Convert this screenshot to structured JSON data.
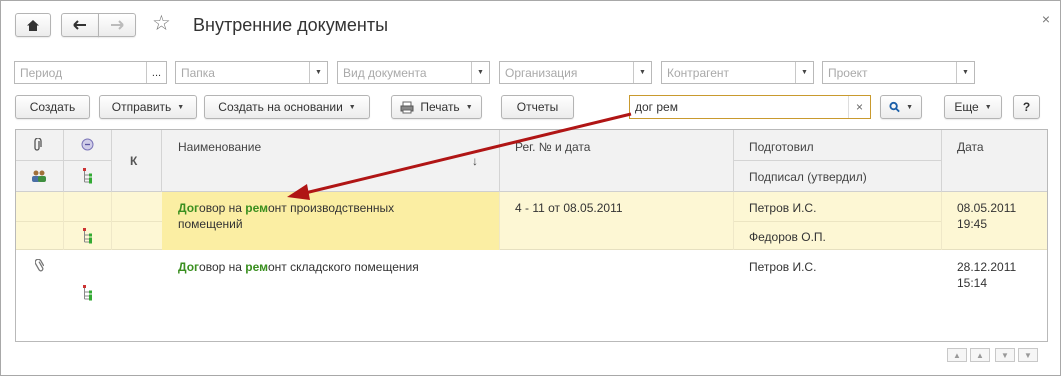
{
  "window": {
    "title": "Внутренние документы"
  },
  "filters": [
    {
      "placeholder": "Период"
    },
    {
      "placeholder": "Папка"
    },
    {
      "placeholder": "Вид документа"
    },
    {
      "placeholder": "Организация"
    },
    {
      "placeholder": "Контрагент"
    },
    {
      "placeholder": "Проект"
    }
  ],
  "toolbar": {
    "create": "Создать",
    "send": "Отправить",
    "create_based_on": "Создать на основании",
    "print": "Печать",
    "reports": "Отчеты",
    "more": "Еще",
    "help": "?"
  },
  "search": {
    "value": "дог рем",
    "clear": "×"
  },
  "columns": {
    "k": "К",
    "name": "Наименование",
    "sort_arrow": "↓",
    "reg": "Рег. № и дата",
    "prepared": "Подготовил",
    "signed": "Подписал (утвердил)",
    "date": "Дата"
  },
  "rows": [
    {
      "name_hl1": "Дог",
      "name_mid1": "овор на ",
      "name_hl2": "рем",
      "name_rest1": "онт производственных",
      "name_line2": "помещений",
      "reg": "4 - 11 от 08.05.2011",
      "prepared": "Петров И.С.",
      "signed": "Федоров О.П.",
      "date1": "08.05.2011",
      "date2": "19:45"
    },
    {
      "name_hl1": "Дог",
      "name_mid1": "овор на ",
      "name_hl2": "рем",
      "name_rest1": "онт складского помещения",
      "prepared": "Петров И.С.",
      "date1": "28.12.2011",
      "date2": "15:14"
    }
  ],
  "colors": {
    "highlight_text": "#3a8f1f",
    "selected_row": "#fdf7d4",
    "selected_cell": "#fbeea3",
    "arrow": "#b01515"
  }
}
